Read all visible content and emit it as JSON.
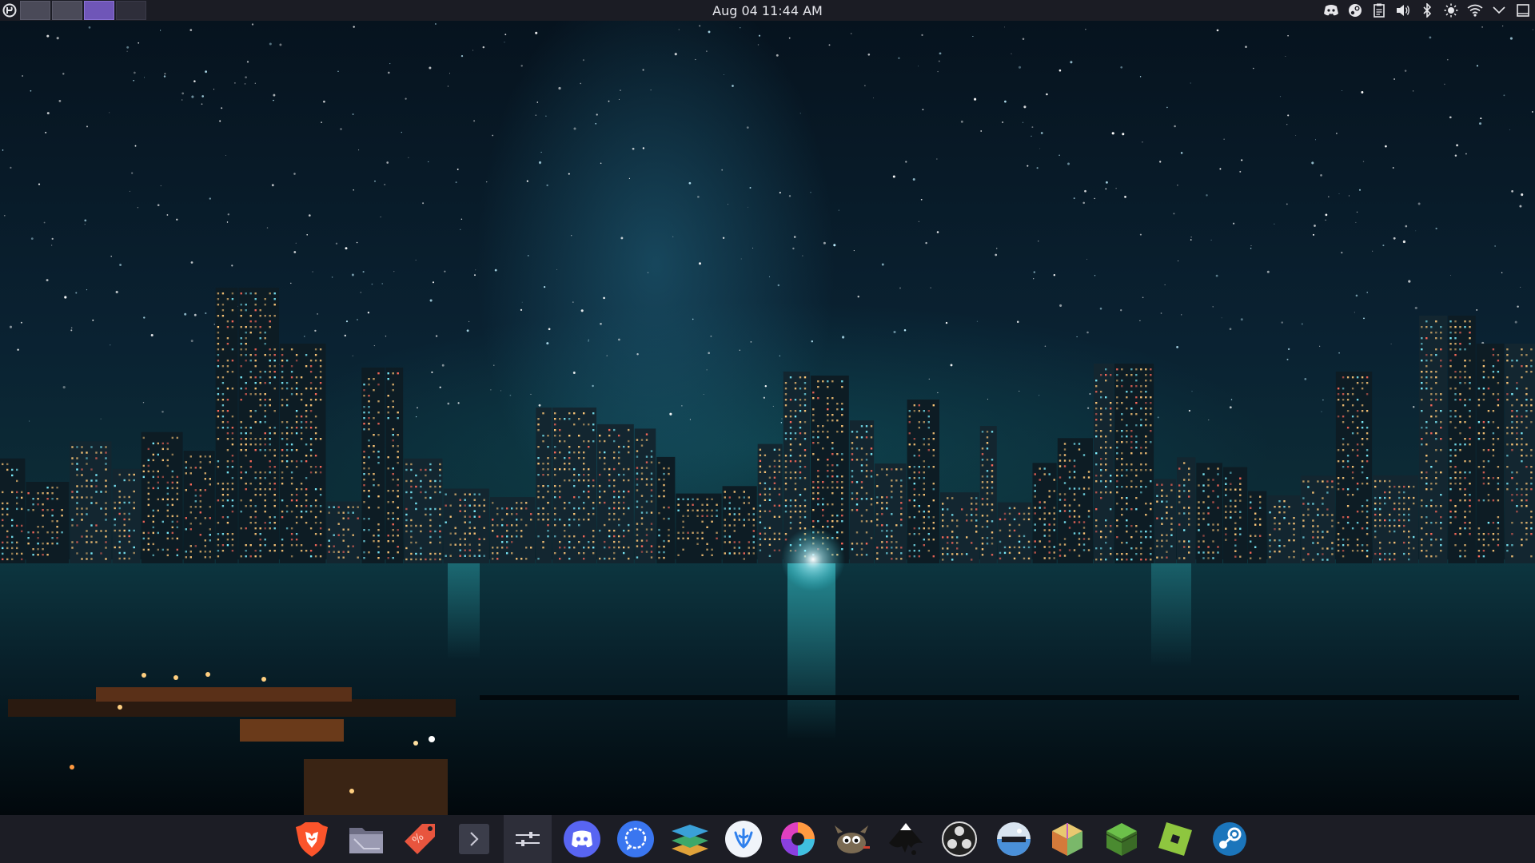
{
  "panel": {
    "clock": "Aug 04 11:44 AM",
    "launcher_icon": "app-launcher-icon",
    "pager": {
      "desktops": 4,
      "active_index": 2
    },
    "tray": [
      {
        "name": "discord-tray-icon"
      },
      {
        "name": "steam-tray-icon"
      },
      {
        "name": "clipboard-icon"
      },
      {
        "name": "volume-icon"
      },
      {
        "name": "bluetooth-icon"
      },
      {
        "name": "brightness-icon"
      },
      {
        "name": "wifi-icon"
      },
      {
        "name": "chevron-down-icon"
      },
      {
        "name": "show-desktop-icon"
      }
    ]
  },
  "dock": {
    "items": [
      {
        "name": "brave-browser",
        "icon": "brave-lion-icon",
        "color": "#fb542b"
      },
      {
        "name": "file-manager",
        "icon": "folder-icon",
        "color": "#8a8aa0"
      },
      {
        "name": "discounts-app",
        "icon": "price-tag-icon",
        "color": "#e8553e"
      },
      {
        "name": "terminal",
        "icon": "terminal-icon",
        "color": "#3b3d4a"
      },
      {
        "name": "system-settings",
        "icon": "sliders-icon",
        "color": "#2d2e39",
        "active": true
      },
      {
        "name": "discord",
        "icon": "discord-icon",
        "color": "#5865f2"
      },
      {
        "name": "signal",
        "icon": "chat-bubble-icon",
        "color": "#3a76f0"
      },
      {
        "name": "layers-app",
        "icon": "layers-icon",
        "color": "#3da86a"
      },
      {
        "name": "vscodium",
        "icon": "vscodium-icon",
        "color": "#2f80ed"
      },
      {
        "name": "color-picker",
        "icon": "color-wheel-icon",
        "color": "#e040c0"
      },
      {
        "name": "gimp",
        "icon": "gimp-icon",
        "color": "#6b5b45"
      },
      {
        "name": "inkscape",
        "icon": "inkscape-icon",
        "color": "#1e1e1e"
      },
      {
        "name": "obs-studio",
        "icon": "obs-icon",
        "color": "#2b2b2b"
      },
      {
        "name": "disk-utility",
        "icon": "disk-icon",
        "color": "#4a90d9"
      },
      {
        "name": "cube-app",
        "icon": "cube-icon",
        "color": "#e0a040"
      },
      {
        "name": "minecraft",
        "icon": "grass-block-icon",
        "color": "#5ba33b"
      },
      {
        "name": "roblox-studio",
        "icon": "roblox-icon",
        "color": "#8ec63f"
      },
      {
        "name": "steam",
        "icon": "steam-icon",
        "color": "#1b75bb"
      }
    ]
  }
}
